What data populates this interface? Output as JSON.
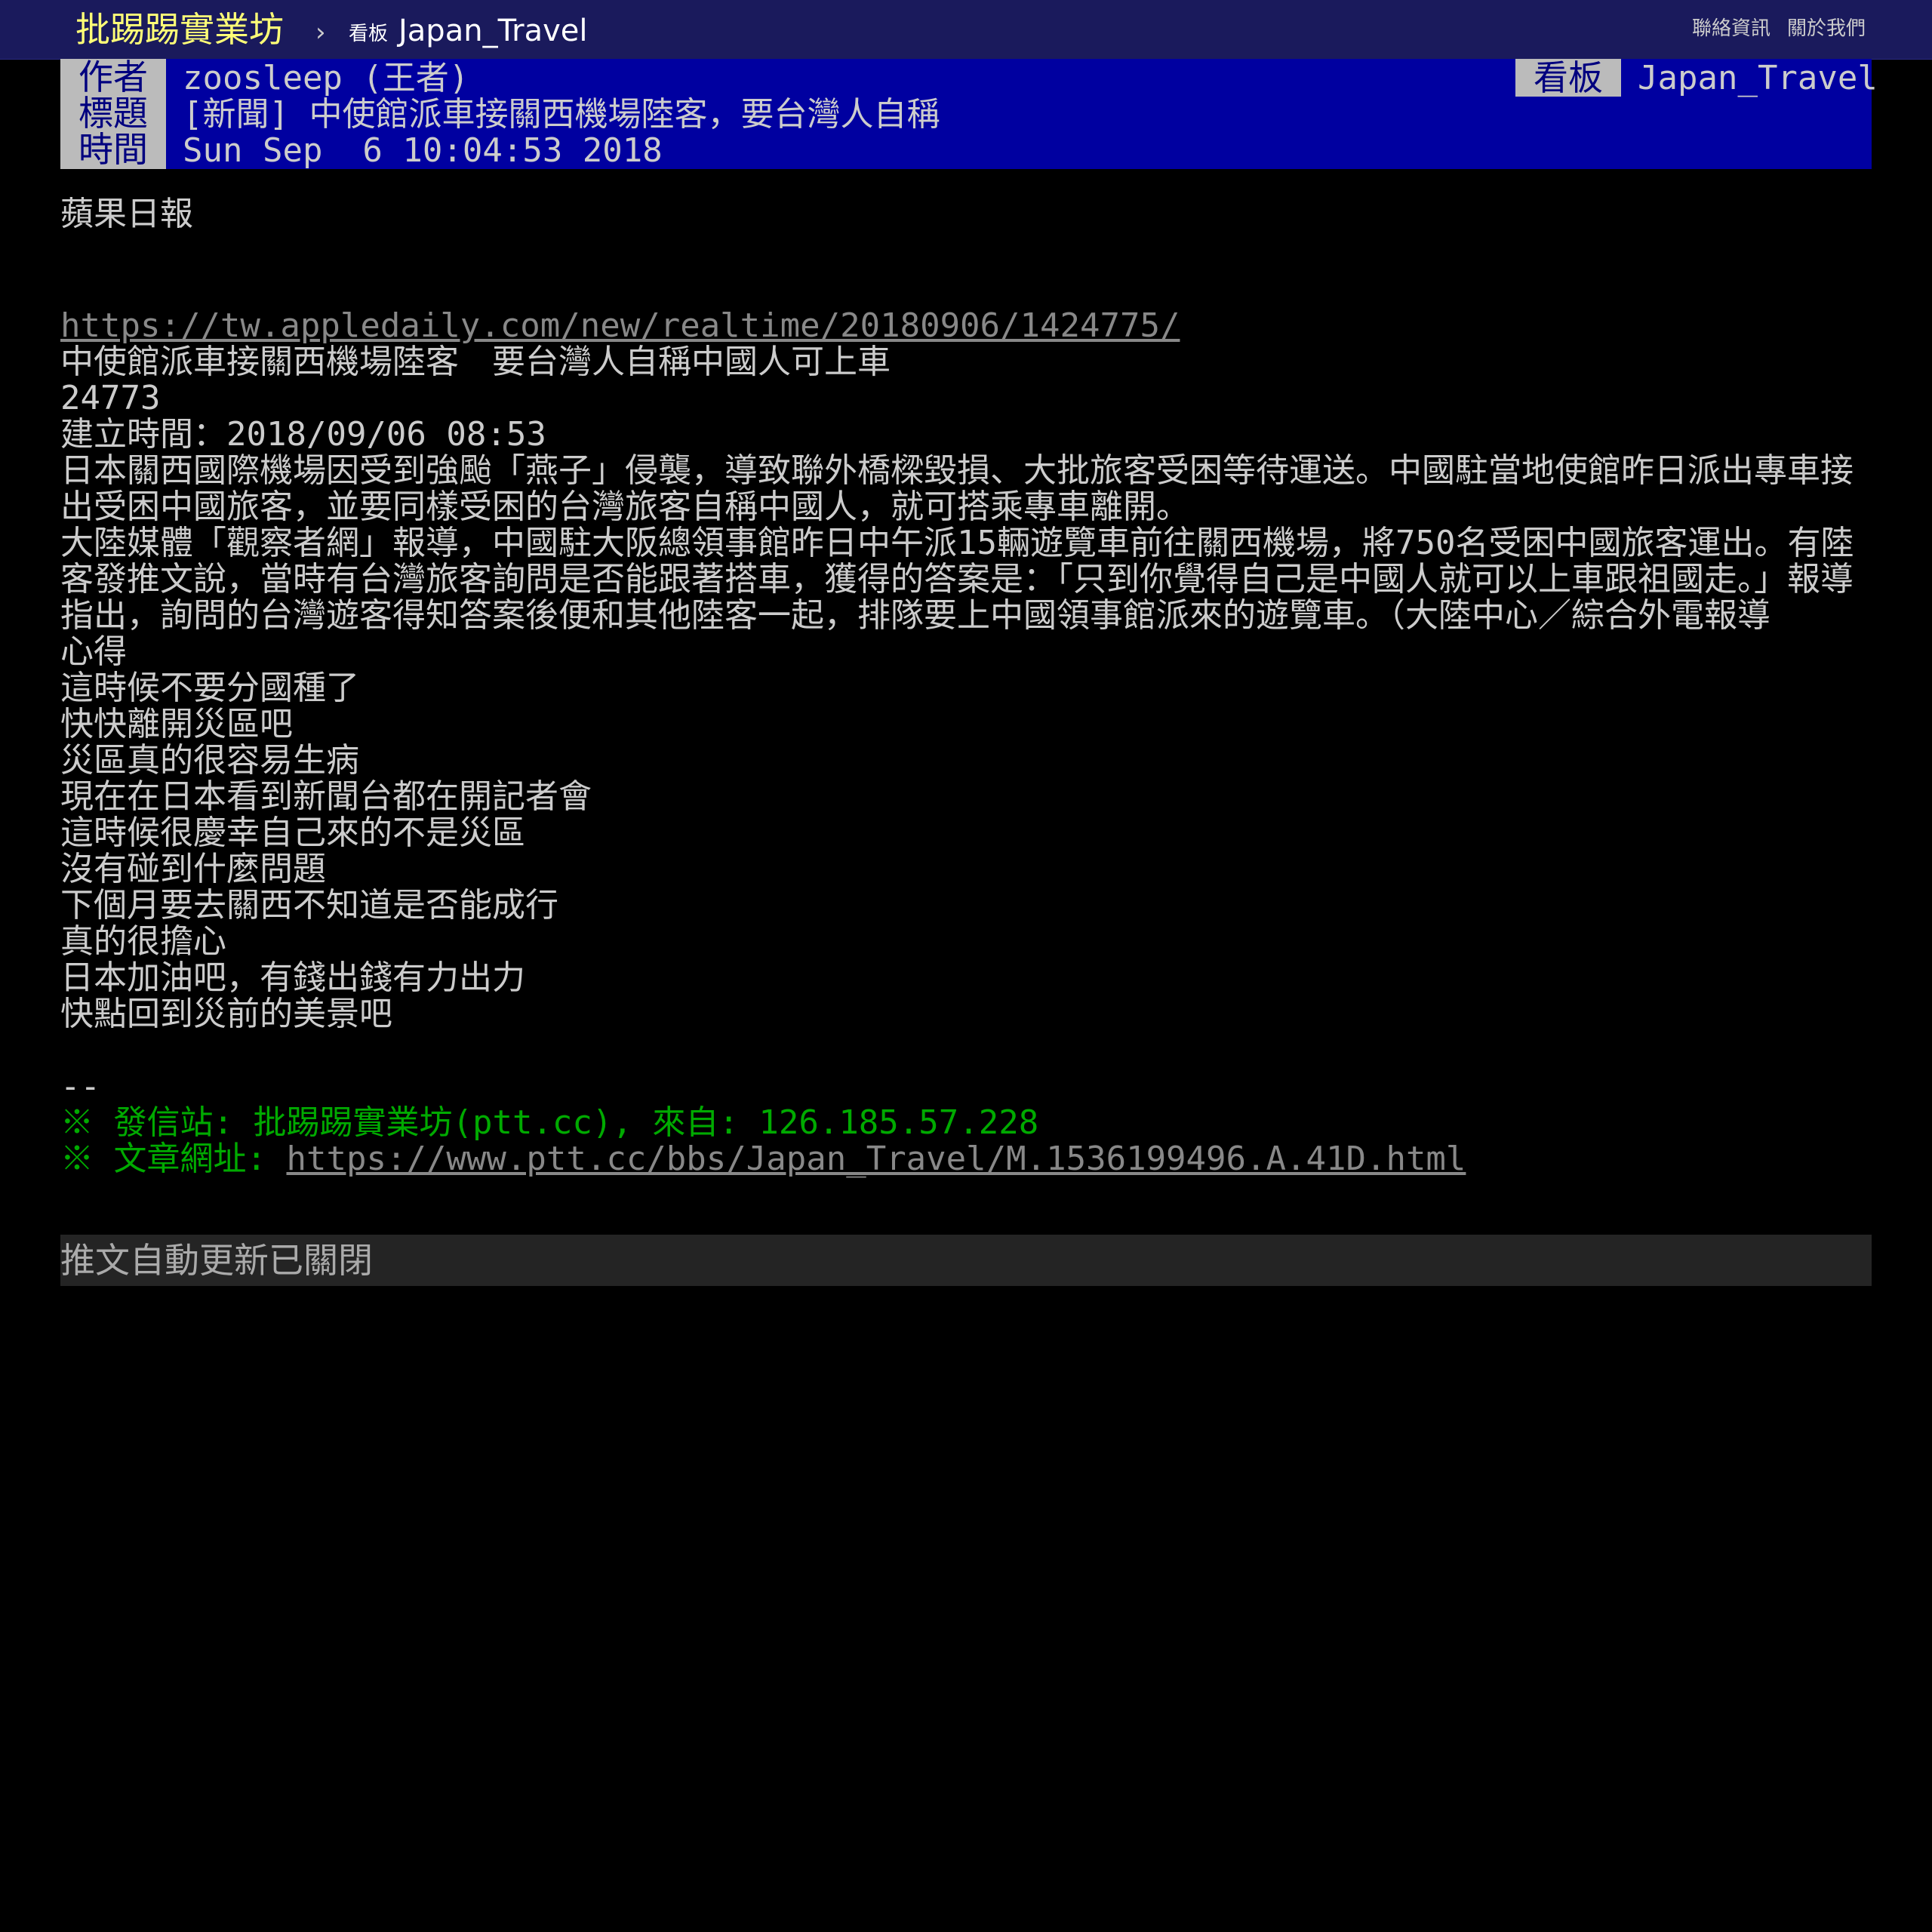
{
  "topbar": {
    "site_name": "批踢踢實業坊",
    "separator": "›",
    "board_kind": "看板",
    "board_name": "Japan_Travel",
    "links": [
      "聯絡資訊",
      "關於我們"
    ]
  },
  "meta": {
    "author_tag": "作者",
    "author": "zoosleep (王者)",
    "title_tag": "標題",
    "title": "[新聞] 中使館派車接關西機場陸客，要台灣人自稱",
    "time_tag": "時間",
    "time": "Sun Sep  6 10:04:53 2018",
    "board_tag": "看板",
    "board": "Japan_Travel"
  },
  "article": {
    "source": "蘋果日報",
    "url": "https://tw.appledaily.com/new/realtime/20180906/1424775/",
    "body_lines": [
      "中使館派車接關西機場陸客　要台灣人自稱中國人可上車",
      "24773",
      "建立時間：2018/09/06 08:53",
      "日本關西國際機場因受到強颱「燕子」侵襲，導致聯外橋樑毀損、大批旅客受困等待運送。中國駐當地使館昨日派出專車接出受困中國旅客，並要同樣受困的台灣旅客自稱中國人，就可搭乘專車離開。",
      "大陸媒體「觀察者網」報導，中國駐大阪總領事館昨日中午派15輛遊覽車前往關西機場，將750名受困中國旅客運出。有陸客發推文說，當時有台灣旅客詢問是否能跟著搭車，獲得的答案是：「只到你覺得自己是中國人就可以上車跟祖國走。」報導指出，詢問的台灣遊客得知答案後便和其他陸客一起，排隊要上中國領事館派來的遊覽車。（大陸中心／綜合外電報導",
      "心得",
      "這時候不要分國種了",
      "快快離開災區吧",
      "災區真的很容易生病",
      "現在在日本看到新聞台都在開記者會",
      "這時候很慶幸自己來的不是災區",
      "沒有碰到什麼問題",
      "下個月要去關西不知道是否能成行",
      "真的很擔心",
      "日本加油吧，有錢出錢有力出力",
      "快點回到災前的美景吧"
    ],
    "signature_sep": "--",
    "footer_origin_label": "※ 發信站: 批踢踢實業坊(ptt.cc), 來自: 126.185.57.228",
    "footer_url_label": "※ 文章網址: ",
    "footer_url": "https://www.ptt.cc/bbs/Japan_Travel/M.1536199496.A.41D.html"
  },
  "push_status": "推文自動更新已關閉",
  "colors": {
    "topbar_bg": "#1a1a5c",
    "site_name": "#ffff77",
    "meta_bg": "#0000a0",
    "meta_tag_bg": "#bbbbbb",
    "footer_green": "#00aa00",
    "push_bar_bg": "#242424"
  }
}
